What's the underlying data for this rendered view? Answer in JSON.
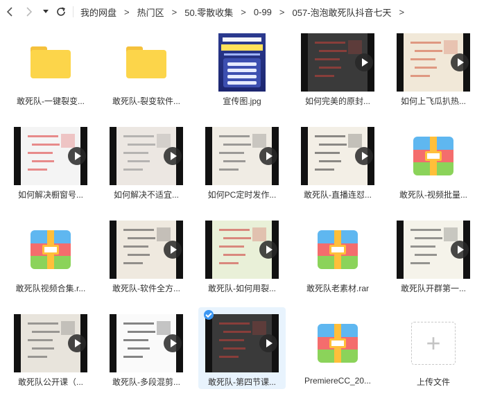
{
  "breadcrumb": [
    "我的网盘",
    "热门区",
    "50.零散收集",
    "0-99",
    "057-泡泡敢死队抖音七天"
  ],
  "files": [
    {
      "name": "敢死队-一键裂变...",
      "kind": "folder"
    },
    {
      "name": "敢死队-裂变软件...",
      "kind": "folder"
    },
    {
      "name": "宣传图.jpg",
      "kind": "image"
    },
    {
      "name": "如何完美的原封...",
      "kind": "video"
    },
    {
      "name": "如何上飞瓜扒热...",
      "kind": "video"
    },
    {
      "name": "如何解决橱窗号...",
      "kind": "video"
    },
    {
      "name": "如何解决不适宜...",
      "kind": "video"
    },
    {
      "name": "如何PC定时发作...",
      "kind": "video"
    },
    {
      "name": "敢死队-直播连怼...",
      "kind": "video"
    },
    {
      "name": "敢死队-视频批量...",
      "kind": "archive"
    },
    {
      "name": "敢死队视频合集.r...",
      "kind": "archive"
    },
    {
      "name": "敢死队-软件全方...",
      "kind": "video"
    },
    {
      "name": "敢死队-如何用裂...",
      "kind": "video"
    },
    {
      "name": "敢死队老素材.rar",
      "kind": "archive"
    },
    {
      "name": "敢死队开群第一...",
      "kind": "video"
    },
    {
      "name": "敢死队公开课（...",
      "kind": "video"
    },
    {
      "name": "敢死队-多段混剪...",
      "kind": "video"
    },
    {
      "name": "敢死队-第四节课...",
      "kind": "video",
      "selected": true
    },
    {
      "name": "PremiereCC_20...",
      "kind": "archive"
    },
    {
      "name": "上传文件",
      "kind": "upload"
    }
  ],
  "poster": {
    "line1": "抖音带货·7天",
    "line2": "从入门到精通"
  },
  "colors": {
    "accent": "#3b97f3",
    "folder": "#fcd54a",
    "selected_bg": "#e8f3fd"
  },
  "icons": {
    "back": "chevron-left-icon",
    "forward": "chevron-right-icon",
    "dropdown": "caret-down-icon",
    "refresh": "refresh-icon",
    "upload": "plus-icon"
  }
}
